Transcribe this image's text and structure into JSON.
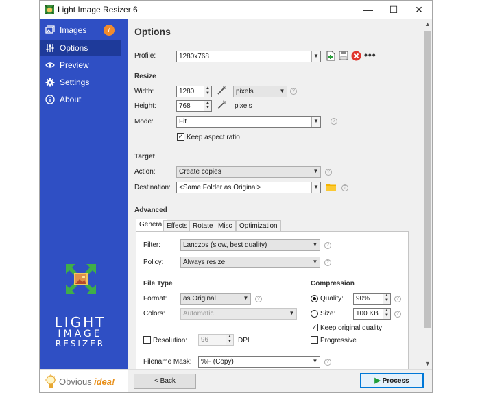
{
  "window": {
    "title": "Light Image Resizer 6",
    "controls": {
      "minimize": "—",
      "maximize": "☐",
      "close": "✕"
    }
  },
  "sidebar": {
    "items": [
      {
        "label": "Images",
        "icon": "images-icon",
        "badge": "7"
      },
      {
        "label": "Options",
        "icon": "sliders-icon",
        "active": true
      },
      {
        "label": "Preview",
        "icon": "eye-icon"
      },
      {
        "label": "Settings",
        "icon": "gear-icon"
      },
      {
        "label": "About",
        "icon": "info-icon"
      }
    ],
    "logo_lines": [
      "LIGHT",
      "IMAGE",
      "RESIZER"
    ],
    "brand_prefix": "Obvious",
    "brand_suffix": "idea!"
  },
  "options": {
    "title": "Options",
    "profile": {
      "label": "Profile:",
      "value": "1280x768"
    },
    "resize": {
      "heading": "Resize",
      "width_label": "Width:",
      "width": "1280",
      "width_unit": "pixels",
      "height_label": "Height:",
      "height": "768",
      "height_unit": "pixels",
      "mode_label": "Mode:",
      "mode": "Fit",
      "keep_aspect": "Keep aspect ratio"
    },
    "target": {
      "heading": "Target",
      "action_label": "Action:",
      "action": "Create copies",
      "destination_label": "Destination:",
      "destination": "<Same Folder as Original>"
    },
    "advanced": {
      "heading": "Advanced",
      "tabs": [
        "General",
        "Effects",
        "Rotate",
        "Misc",
        "Optimization"
      ],
      "filter_label": "Filter:",
      "filter": "Lanczos  (slow, best quality)",
      "policy_label": "Policy:",
      "policy": "Always resize",
      "filetype_heading": "File Type",
      "format_label": "Format:",
      "format": "as Original",
      "colors_label": "Colors:",
      "colors": "Automatic",
      "resolution_label": "Resolution:",
      "resolution": "96",
      "resolution_unit": "DPI",
      "compression_heading": "Compression",
      "quality_label": "Quality:",
      "quality": "90%",
      "size_label": "Size:",
      "size": "100 KB",
      "keep_quality": "Keep original quality",
      "progressive": "Progressive",
      "mask_label": "Filename Mask:",
      "mask": "%F (Copy)"
    }
  },
  "buttons": {
    "back": "< Back",
    "process": "Process"
  },
  "colors": {
    "sidebar": "#2f4fc4",
    "active": "#1e3a9a",
    "badge": "#f28b2c",
    "accent": "#0078d7"
  }
}
